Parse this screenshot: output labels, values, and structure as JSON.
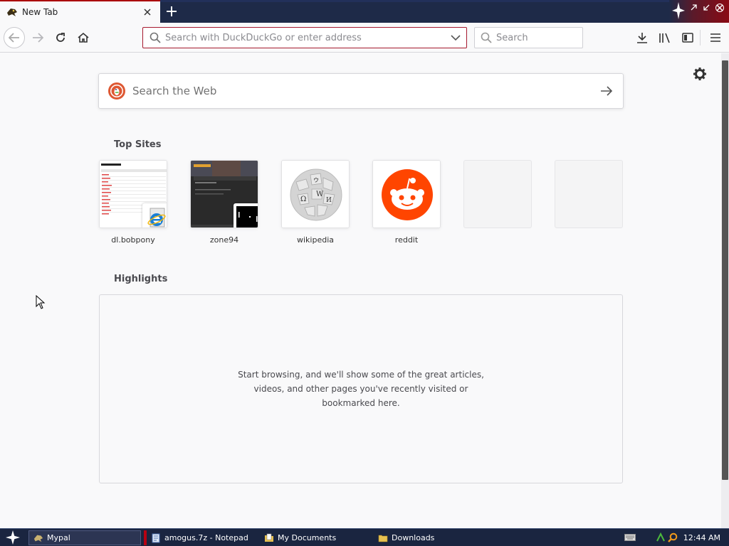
{
  "tab": {
    "title": "New Tab"
  },
  "navbar": {
    "url_placeholder": "Search with DuckDuckGo or enter address",
    "search_placeholder": "Search"
  },
  "newtab_page": {
    "web_search_placeholder": "Search the Web",
    "top_sites_heading": "Top Sites",
    "top_sites": [
      {
        "label": "dl.bobpony"
      },
      {
        "label": "zone94"
      },
      {
        "label": "wikipedia"
      },
      {
        "label": "reddit"
      },
      {
        "label": ""
      },
      {
        "label": ""
      }
    ],
    "highlights_heading": "Highlights",
    "highlights_empty_message": "Start browsing, and we'll show some of the great articles, videos, and other pages you've recently visited or bookmarked here."
  },
  "taskbar": {
    "tasks": [
      {
        "label": "Mypal"
      },
      {
        "label": "amogus.7z - Notepad"
      },
      {
        "label": "My Documents"
      },
      {
        "label": "Downloads"
      }
    ],
    "clock": "12:44 AM"
  },
  "colors": {
    "accent_red": "#a6192e",
    "reddit_orange": "#ff4500",
    "taskbar_bg": "#1a2540"
  }
}
